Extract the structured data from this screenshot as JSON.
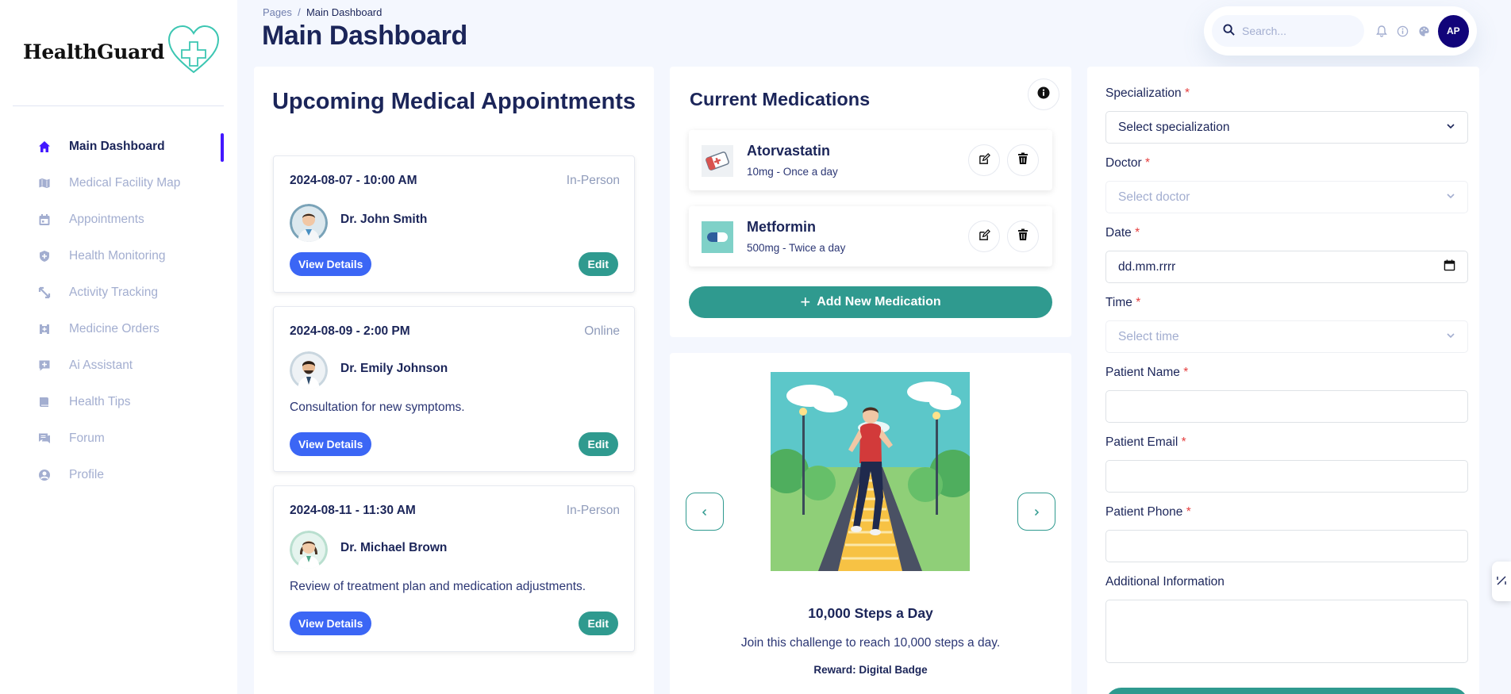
{
  "app": {
    "logo_text": "HealthGuard",
    "logo_icon": "heart-plus-icon"
  },
  "sidebar": {
    "items": [
      {
        "label": "Main Dashboard",
        "icon": "home-icon",
        "active": true
      },
      {
        "label": "Medical Facility Map",
        "icon": "map-icon"
      },
      {
        "label": "Appointments",
        "icon": "calendar-icon"
      },
      {
        "label": "Health Monitoring",
        "icon": "shield-icon"
      },
      {
        "label": "Activity Tracking",
        "icon": "activity-icon"
      },
      {
        "label": "Medicine Orders",
        "icon": "medicine-icon"
      },
      {
        "label": "Ai Assistant",
        "icon": "ai-assistant-icon"
      },
      {
        "label": "Health Tips",
        "icon": "book-icon"
      },
      {
        "label": "Forum",
        "icon": "forum-icon"
      },
      {
        "label": "Profile",
        "icon": "profile-icon"
      }
    ]
  },
  "header": {
    "breadcrumb_root": "Pages",
    "breadcrumb_sep": "/",
    "breadcrumb_current": "Main Dashboard",
    "title": "Main Dashboard",
    "search_placeholder": "Search...",
    "avatar_initials": "AP"
  },
  "appointments": {
    "title": "Upcoming Medical Appointments",
    "view_label": "View Details",
    "edit_label": "Edit",
    "items": [
      {
        "datetime": "2024-08-07 - 10:00 AM",
        "type": "In-Person",
        "doctor": "Dr. John Smith",
        "note": ""
      },
      {
        "datetime": "2024-08-09 - 2:00 PM",
        "type": "Online",
        "doctor": "Dr. Emily Johnson",
        "note": "Consultation for new symptoms."
      },
      {
        "datetime": "2024-08-11 - 11:30 AM",
        "type": "In-Person",
        "doctor": "Dr. Michael Brown",
        "note": "Review of treatment plan and medication adjustments."
      }
    ]
  },
  "medications": {
    "title": "Current Medications",
    "add_label": "Add New Medication",
    "items": [
      {
        "name": "Atorvastatin",
        "dose": "10mg - Once a day"
      },
      {
        "name": "Metformin",
        "dose": "500mg - Twice a day"
      }
    ]
  },
  "challenge": {
    "title": "10,000 Steps a Day",
    "description": "Join this challenge to reach 10,000 steps a day.",
    "reward": "Reward: Digital Badge"
  },
  "form": {
    "specialization_label": "Specialization",
    "specialization_value": "Select specialization",
    "doctor_label": "Doctor",
    "doctor_value": "Select doctor",
    "date_label": "Date",
    "date_value": "dd.mm.rrrr",
    "time_label": "Time",
    "time_value": "Select time",
    "patient_name_label": "Patient Name",
    "patient_email_label": "Patient Email",
    "patient_phone_label": "Patient Phone",
    "additional_label": "Additional Information",
    "required_mark": "*"
  },
  "colors": {
    "accent": "#4318ff",
    "navy": "#1b2559",
    "teal": "#2f9a8f",
    "blue_button": "#3b66f5",
    "muted": "#a3aed0"
  }
}
